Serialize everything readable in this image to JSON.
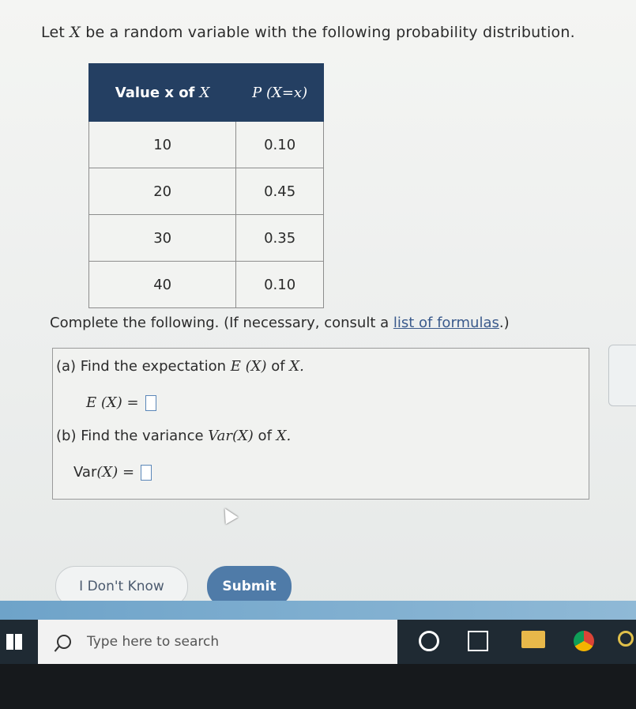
{
  "question": {
    "intro_pre": "Let ",
    "intro_var": "X",
    "intro_post": " be a random variable with the following probability distribution."
  },
  "table": {
    "col1_label": "Value x of ",
    "col1_var": "X",
    "col2_label": "P (X=x)",
    "rows": [
      {
        "x": "10",
        "p": "0.10"
      },
      {
        "x": "20",
        "p": "0.45"
      },
      {
        "x": "30",
        "p": "0.35"
      },
      {
        "x": "40",
        "p": "0.10"
      }
    ]
  },
  "instructions": {
    "text": "Complete the following. (If necessary, consult a ",
    "link": "list of formulas",
    "suffix": ".)"
  },
  "part_a": {
    "label_pre": "(a) Find the expectation ",
    "label_math": "E (X)",
    "label_mid": " of ",
    "label_var": "X.",
    "answer_lhs": "E (X) ="
  },
  "part_b": {
    "label_pre": "(b) Find the variance ",
    "label_math": "Var(X)",
    "label_mid": " of ",
    "label_var": "X.",
    "answer_lhs_fn": "Var",
    "answer_lhs_math": "(X) ="
  },
  "buttons": {
    "dont_know": "I Don't Know",
    "submit": "Submit"
  },
  "taskbar": {
    "search_placeholder": "Type here to search"
  },
  "colors": {
    "table_header": "#243f62",
    "submit": "#4f7ba8",
    "link": "#3a5a8c"
  }
}
